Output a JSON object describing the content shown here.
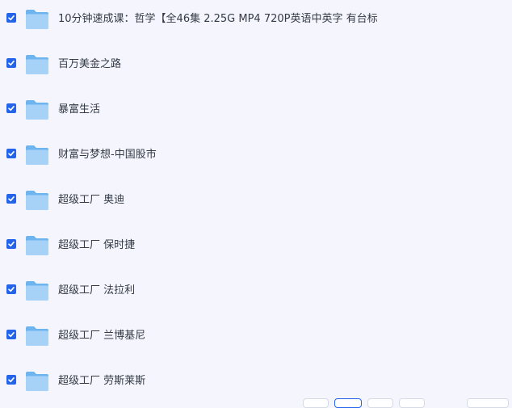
{
  "files": [
    {
      "name": "10分钟速成课：哲学【全46集 2.25G MP4 720P英语中英字 有台标",
      "checked": true,
      "icon": "folder-icon"
    },
    {
      "name": "百万美金之路",
      "checked": true,
      "icon": "folder-icon"
    },
    {
      "name": "暴富生活",
      "checked": true,
      "icon": "folder-icon"
    },
    {
      "name": "财富与梦想-中国股市",
      "checked": true,
      "icon": "folder-icon"
    },
    {
      "name": "超级工厂 奥迪",
      "checked": true,
      "icon": "folder-icon"
    },
    {
      "name": "超级工厂 保时捷",
      "checked": true,
      "icon": "folder-icon"
    },
    {
      "name": "超级工厂 法拉利",
      "checked": true,
      "icon": "folder-icon"
    },
    {
      "name": "超级工厂 兰博基尼",
      "checked": true,
      "icon": "folder-icon"
    },
    {
      "name": "超级工厂 劳斯莱斯",
      "checked": true,
      "icon": "folder-icon"
    }
  ],
  "colors": {
    "background": "#f5f6fd",
    "checkbox": "#2463eb",
    "folder_light": "#a7d2f7",
    "folder_dark": "#6eb4ef",
    "text": "#333a44"
  }
}
